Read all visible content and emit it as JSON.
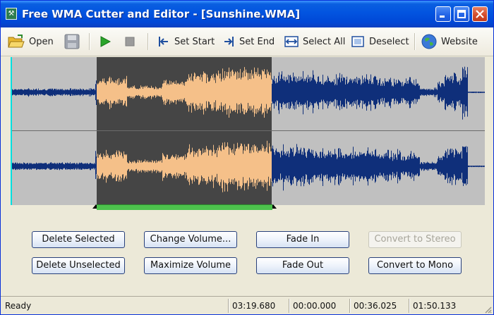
{
  "window": {
    "title": "Free WMA Cutter and Editor - [Sunshine.WMA]"
  },
  "toolbar": {
    "open_label": "Open",
    "set_start_label": "Set Start",
    "set_end_label": "Set End",
    "select_all_label": "Select All",
    "deselect_label": "Deselect",
    "website_label": "Website"
  },
  "buttons": {
    "delete_selected": "Delete Selected",
    "change_volume": "Change Volume...",
    "fade_in": "Fade In",
    "convert_to_stereo": "Convert to Stereo",
    "delete_unselected": "Delete Unselected",
    "maximize_volume": "Maximize Volume",
    "fade_out": "Fade Out",
    "convert_to_mono": "Convert to Mono"
  },
  "status": {
    "state": "Ready",
    "total_length": "03:19.680",
    "cursor_time": "00:00.000",
    "selection_start": "00:36.025",
    "selection_end": "01:50.133"
  },
  "colors": {
    "unselected_wave": "#0f2f7a",
    "selected_wave": "#f5c089",
    "selection_bg": "#454545",
    "unselected_bg": "#c0c0c0",
    "selection_bar": "#4dc24d"
  }
}
